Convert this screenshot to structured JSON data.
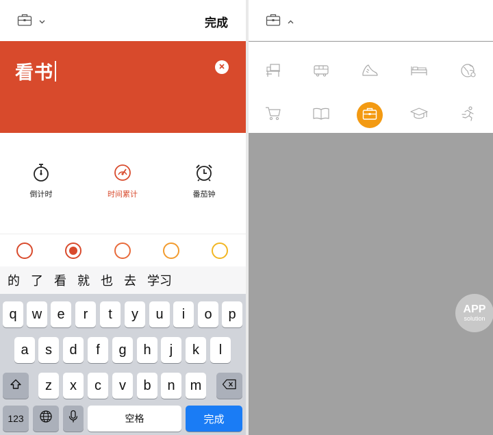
{
  "left": {
    "done_label": "完成",
    "task_title": "看书",
    "accent_color": "#d84a2c",
    "modes": [
      {
        "label": "倒计时",
        "icon": "stopwatch-icon",
        "active": false
      },
      {
        "label": "时间累计",
        "icon": "speedometer-icon",
        "active": true
      },
      {
        "label": "番茄钟",
        "icon": "alarm-clock-icon",
        "active": false
      }
    ],
    "color_options": [
      {
        "color": "#d84a2c",
        "selected": false
      },
      {
        "color": "#d84a2c",
        "selected": true
      },
      {
        "color": "#e86a3a",
        "selected": false
      },
      {
        "color": "#f29b2e",
        "selected": false
      },
      {
        "color": "#f2b622",
        "selected": false
      }
    ]
  },
  "keyboard": {
    "suggestions": [
      "的",
      "了",
      "看",
      "就",
      "也",
      "去",
      "学习"
    ],
    "row1": [
      "q",
      "w",
      "e",
      "r",
      "t",
      "y",
      "u",
      "i",
      "o",
      "p"
    ],
    "row2": [
      "a",
      "s",
      "d",
      "f",
      "g",
      "h",
      "j",
      "k",
      "l"
    ],
    "row3": [
      "z",
      "x",
      "c",
      "v",
      "b",
      "n",
      "m"
    ],
    "numbers_label": "123",
    "space_label": "空格",
    "return_label": "完成",
    "return_color": "#1a7cf5"
  },
  "right": {
    "selected_icon": "briefcase-icon",
    "selected_color": "#f39a12",
    "icons": [
      "desk-icon",
      "bus-icon",
      "shoe-icon",
      "bed-icon",
      "globe-icon",
      "cart-icon",
      "book-icon",
      "briefcase-icon",
      "graduation-cap-icon",
      "runner-icon"
    ],
    "watermark_line1": "APP",
    "watermark_line2": "solution"
  }
}
